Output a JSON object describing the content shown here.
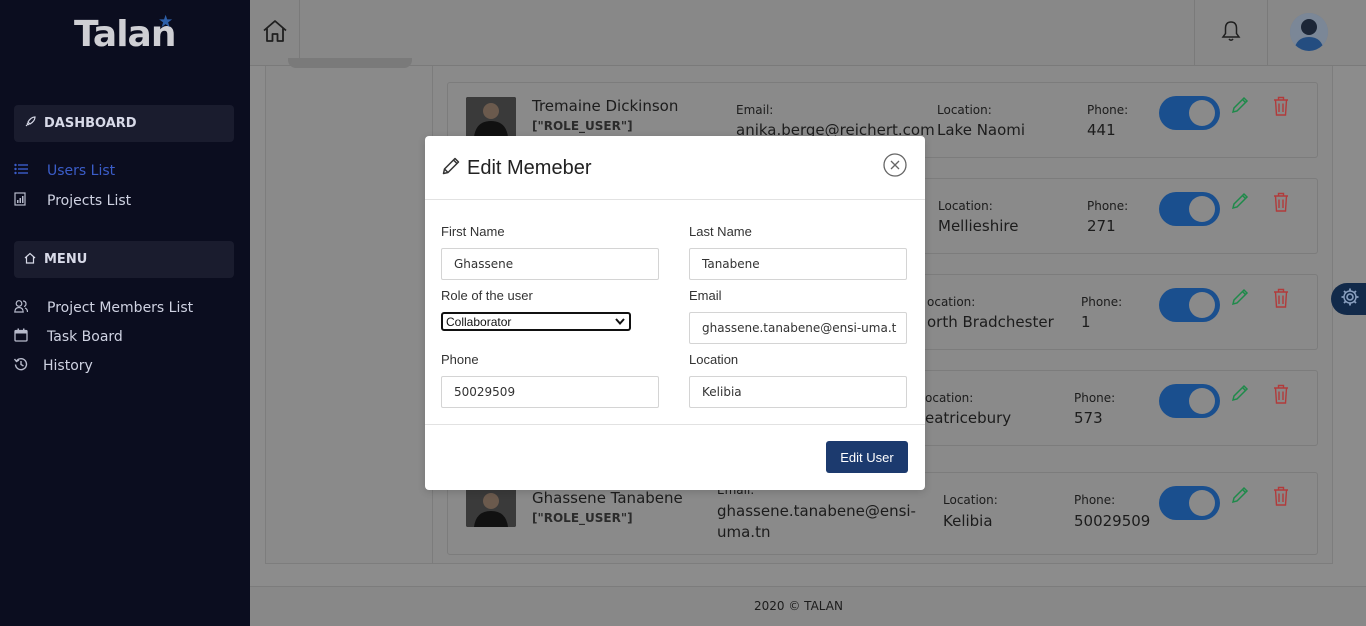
{
  "app": {
    "logo_text": "Talan",
    "footer_text": "2020 © TALAN"
  },
  "sidebar": {
    "dashboard_label": "DASHBOARD",
    "menu_label": "MENU",
    "items": [
      {
        "label": "Users List",
        "icon": "list-icon",
        "active": true
      },
      {
        "label": "Projects List",
        "icon": "chart-icon",
        "active": false
      },
      {
        "label": "Project Members List",
        "icon": "users-icon",
        "active": false
      },
      {
        "label": "Task Board",
        "icon": "calendar-icon",
        "active": false
      },
      {
        "label": "History",
        "icon": "history-icon",
        "active": false
      }
    ]
  },
  "users": [
    {
      "name": "Tremaine Dickinson",
      "role": "[\"ROLE_USER\"]",
      "email_label": "Email:",
      "email": "anika.berge@reichert.com",
      "location_label": "Location:",
      "location": "Lake Naomi",
      "phone_label": "Phone:",
      "phone": "441"
    },
    {
      "location_label": "Location:",
      "location": "Mellieshire",
      "phone_label": "Phone:",
      "phone": "271"
    },
    {
      "location_label": "ocation:",
      "location": "orth Bradchester",
      "phone_label": "Phone:",
      "phone": "1"
    },
    {
      "location_label": "ocation:",
      "location": "eatricebury",
      "phone_label": "Phone:",
      "phone": "573"
    },
    {
      "name": "Ghassene Tanabene",
      "role": "[\"ROLE_USER\"]",
      "email_label": "Email:",
      "email_line1": "ghassene.tanabene@ensi-",
      "email_line2": "uma.tn",
      "location_label": "Location:",
      "location": "Kelibia",
      "phone_label": "Phone:",
      "phone": "50029509"
    }
  ],
  "modal": {
    "title": "Edit Memeber",
    "fields": {
      "first_name_label": "First Name",
      "first_name_value": "Ghassene",
      "last_name_label": "Last Name",
      "last_name_value": "Tanabene",
      "role_label": "Role of the user",
      "role_value": "Collaborator",
      "email_label": "Email",
      "email_value": "ghassene.tanabene@ensi-uma.t",
      "phone_label": "Phone",
      "phone_value": "50029509",
      "location_label": "Location",
      "location_value": "Kelibia"
    },
    "submit_label": "Edit User"
  },
  "colors": {
    "sidebar_bg": "#0b0d1f",
    "accent": "#1c3a6e",
    "active_link": "#3b5dc9",
    "edit_green": "#1e8a4a",
    "delete_red": "#b13b3b"
  }
}
